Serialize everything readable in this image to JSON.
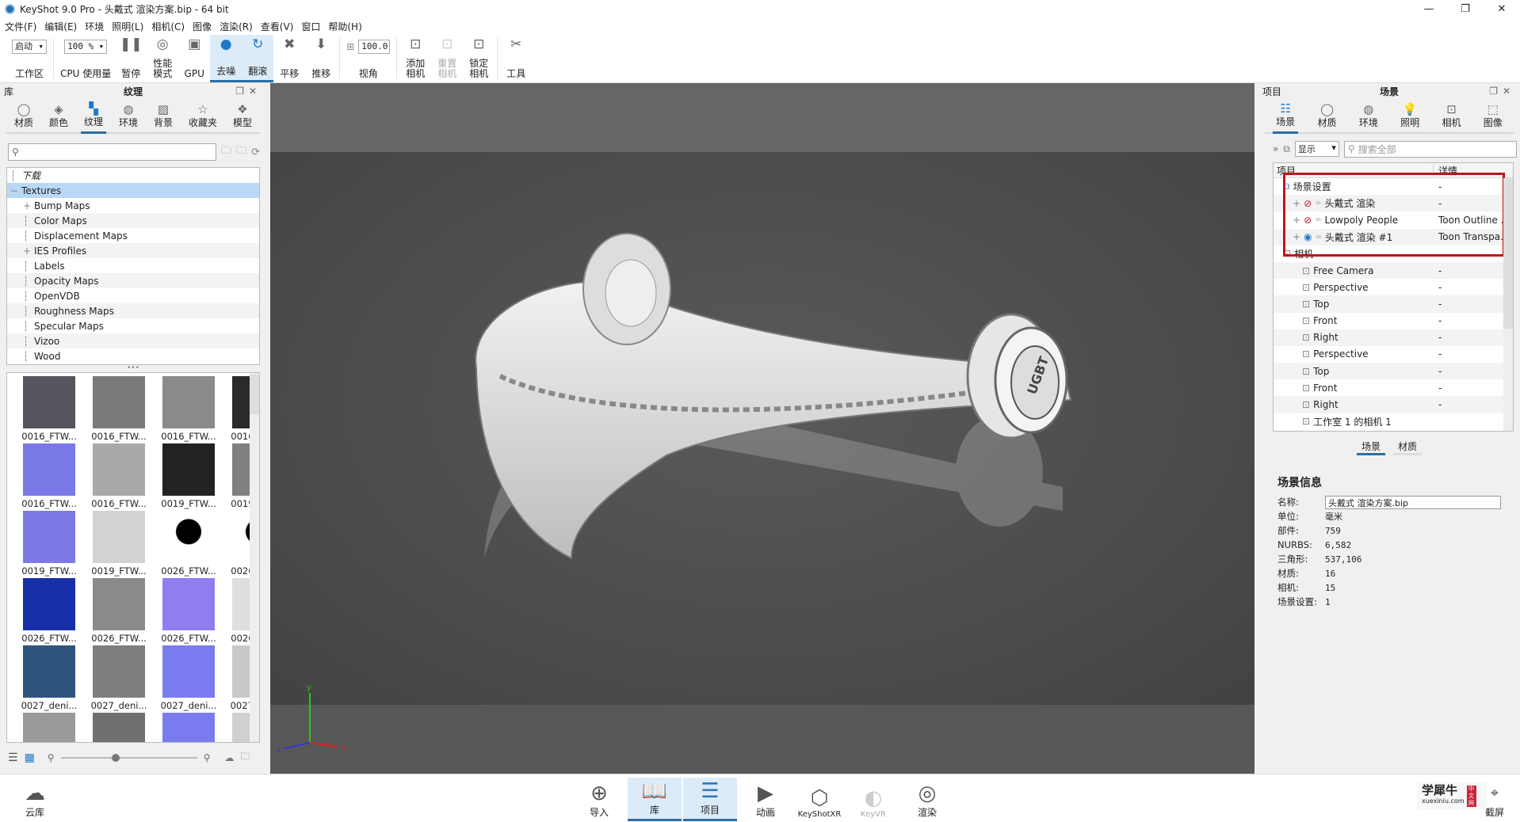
{
  "window": {
    "title": "KeyShot 9.0 Pro  - 头戴式 渲染方案.bip  - 64 bit",
    "controls": [
      "—",
      "❐",
      "✕"
    ]
  },
  "menu": [
    "文件(F)",
    "编辑(E)",
    "环境",
    "照明(L)",
    "相机(C)",
    "图像",
    "渲染(R)",
    "查看(V)",
    "窗口",
    "帮助(H)"
  ],
  "toolbar": {
    "workspace": {
      "value": "启动",
      "label": "工作区"
    },
    "cpu": {
      "value": "100 %",
      "label": "CPU 使用量"
    },
    "buttons": [
      {
        "label": "暂停",
        "icon": "pause-icon",
        "glyph": "❚❚"
      },
      {
        "label": "性能\n模式",
        "icon": "performance-icon",
        "glyph": "◎"
      },
      {
        "label": "GPU",
        "icon": "gpu-icon",
        "glyph": "▣"
      },
      {
        "label": "去噪",
        "icon": "denoise-icon",
        "glyph": "●",
        "active": true
      },
      {
        "label": "翻滚",
        "icon": "tumble-icon",
        "glyph": "↻",
        "active": true
      },
      {
        "label": "平移",
        "icon": "pan-icon",
        "glyph": "✖"
      },
      {
        "label": "推移",
        "icon": "dolly-icon",
        "glyph": "⬇"
      }
    ],
    "fov": {
      "value": "100.0",
      "label": "视角"
    },
    "camera_buttons": [
      {
        "label": "添加\n相机",
        "icon": "add-camera-icon",
        "glyph": "⊡"
      },
      {
        "label": "重置\n相机",
        "icon": "reset-camera-icon",
        "glyph": "⊡",
        "disabled": true
      },
      {
        "label": "锁定\n相机",
        "icon": "lock-camera-icon",
        "glyph": "⊡"
      }
    ],
    "tools": {
      "label": "工具",
      "icon": "tools-icon",
      "glyph": "✂"
    }
  },
  "library": {
    "panel_left": "库",
    "title": "纹理",
    "tabs": [
      {
        "label": "材质",
        "icon": "material-icon",
        "glyph": "◯"
      },
      {
        "label": "颜色",
        "icon": "color-icon",
        "glyph": "◈"
      },
      {
        "label": "纹理",
        "icon": "texture-icon",
        "glyph": "▚",
        "active": true
      },
      {
        "label": "环境",
        "icon": "environment-icon",
        "glyph": "◍"
      },
      {
        "label": "背景",
        "icon": "background-icon",
        "glyph": "▨"
      },
      {
        "label": "收藏夹",
        "icon": "favorites-icon",
        "glyph": "☆"
      },
      {
        "label": "模型",
        "icon": "models-icon",
        "glyph": "❖"
      }
    ],
    "search_placeholder": "",
    "tree": [
      {
        "label": "下载",
        "indent": 0,
        "italic": true
      },
      {
        "label": "Textures",
        "indent": 0,
        "expander": "−",
        "selected": true
      },
      {
        "label": "Bump Maps",
        "indent": 1,
        "expander": "+"
      },
      {
        "label": "Color Maps",
        "indent": 1
      },
      {
        "label": "Displacement Maps",
        "indent": 1
      },
      {
        "label": "IES Profiles",
        "indent": 1,
        "expander": "+"
      },
      {
        "label": "Labels",
        "indent": 1
      },
      {
        "label": "Opacity Maps",
        "indent": 1
      },
      {
        "label": "OpenVDB",
        "indent": 1
      },
      {
        "label": "Roughness Maps",
        "indent": 1
      },
      {
        "label": "Specular Maps",
        "indent": 1
      },
      {
        "label": "Vizoo",
        "indent": 1
      },
      {
        "label": "Wood",
        "indent": 1
      }
    ],
    "thumbnails": [
      {
        "label": "0016_FTW...",
        "color": "#58545e"
      },
      {
        "label": "0016_FTW...",
        "color": "#7a7a7a"
      },
      {
        "label": "0016_FTW...",
        "color": "#8a8a8a"
      },
      {
        "label": "0016_FTW...",
        "color": "#2a2a2a"
      },
      {
        "label": "0016_FTW...",
        "color": "#7b78e8"
      },
      {
        "label": "0016_FTW...",
        "color": "#a9a9a9"
      },
      {
        "label": "0019_FTW...",
        "color": "#222220"
      },
      {
        "label": "0019_FTW...",
        "color": "#808080"
      },
      {
        "label": "0019_FTW...",
        "color": "#7d7ae6"
      },
      {
        "label": "0019_FTW...",
        "color": "#d2d2d2"
      },
      {
        "label": "0026_FTW...",
        "color": "#ffffff",
        "pattern": "holes"
      },
      {
        "label": "0026_FTW...",
        "color": "#ffffff",
        "pattern": "holes"
      },
      {
        "label": "0026_FTW...",
        "color": "#1730a8"
      },
      {
        "label": "0026_FTW...",
        "color": "#8a8a8a"
      },
      {
        "label": "0026_FTW...",
        "color": "#8f7ef0"
      },
      {
        "label": "0026_FTW...",
        "color": "#dedede"
      },
      {
        "label": "0027_deni...",
        "color": "#2f557e"
      },
      {
        "label": "0027_deni...",
        "color": "#7e7e7e"
      },
      {
        "label": "0027_deni...",
        "color": "#7b7bf0"
      },
      {
        "label": "0027_deni...",
        "color": "#c9c9c9"
      },
      {
        "label": "",
        "color": "#9a9a9a"
      },
      {
        "label": "",
        "color": "#707070"
      },
      {
        "label": "",
        "color": "#7b7bf0"
      },
      {
        "label": "",
        "color": "#d0d0d0"
      }
    ],
    "zoom_slider": 0.4
  },
  "project": {
    "panel_left": "项目",
    "title": "场景",
    "tabs": [
      {
        "label": "场景",
        "icon": "scene-icon",
        "glyph": "☷",
        "active": true
      },
      {
        "label": "材质",
        "icon": "material-icon",
        "glyph": "◯"
      },
      {
        "label": "环境",
        "icon": "environment-icon",
        "glyph": "◍"
      },
      {
        "label": "照明",
        "icon": "lighting-icon",
        "glyph": "💡"
      },
      {
        "label": "相机",
        "icon": "camera-icon",
        "glyph": "⊡"
      },
      {
        "label": "图像",
        "icon": "image-icon",
        "glyph": "⬚"
      }
    ],
    "show_select": "显示",
    "search_placeholder": "搜索全部",
    "columns": [
      "项目",
      "详情"
    ],
    "rows": [
      {
        "label": "场景设置",
        "detail": "-",
        "indent": 1,
        "icon": "scene-set-icon"
      },
      {
        "label": "头戴式 渲染",
        "detail": "-",
        "indent": 2,
        "expander": "+",
        "visible": false
      },
      {
        "label": "Lowpoly People",
        "detail": "Toon Outline ...",
        "indent": 2,
        "expander": "+",
        "visible": false
      },
      {
        "label": "头戴式 渲染 #1",
        "detail": "Toon Transpa...",
        "indent": 2,
        "expander": "+",
        "visible": true
      },
      {
        "label": "相机",
        "detail": "",
        "indent": 1,
        "icon": "camera"
      },
      {
        "label": "Free Camera",
        "detail": "-",
        "indent": 3,
        "icon": "camera"
      },
      {
        "label": "Perspective",
        "detail": "-",
        "indent": 3,
        "icon": "camera"
      },
      {
        "label": "Top",
        "detail": "-",
        "indent": 3,
        "icon": "camera"
      },
      {
        "label": "Front",
        "detail": "-",
        "indent": 3,
        "icon": "camera"
      },
      {
        "label": "Right",
        "detail": "-",
        "indent": 3,
        "icon": "camera"
      },
      {
        "label": "Perspective",
        "detail": "-",
        "indent": 3,
        "icon": "camera"
      },
      {
        "label": "Top",
        "detail": "-",
        "indent": 3,
        "icon": "camera"
      },
      {
        "label": "Front",
        "detail": "-",
        "indent": 3,
        "icon": "camera"
      },
      {
        "label": "Right",
        "detail": "-",
        "indent": 3,
        "icon": "camera"
      },
      {
        "label": "工作室 1 的相机 1",
        "detail": "",
        "indent": 3,
        "icon": "camera"
      }
    ],
    "highlight_color": "#c0141c",
    "subtabs": [
      "场景",
      "材质"
    ],
    "info": {
      "title": "场景信息",
      "name_label": "名称:",
      "name_value": "头戴式 渲染方案.bip",
      "rows": [
        {
          "k": "单位:",
          "v": "毫米"
        },
        {
          "k": "部件:",
          "v": "759"
        },
        {
          "k": "NURBS:",
          "v": "6,582"
        },
        {
          "k": "三角形:",
          "v": "537,106"
        },
        {
          "k": "材质:",
          "v": "16"
        },
        {
          "k": "相机:",
          "v": "15"
        },
        {
          "k": "场景设置:",
          "v": "1"
        }
      ]
    }
  },
  "viewport": {
    "axis_labels": [
      "y",
      "x",
      "z"
    ],
    "logo_text": "UGBT"
  },
  "bottombar": {
    "cloud": "云库",
    "items": [
      {
        "label": "导入",
        "icon": "import-icon",
        "glyph": "⊕"
      },
      {
        "label": "库",
        "icon": "library-icon",
        "glyph": "📖",
        "active": true
      },
      {
        "label": "项目",
        "icon": "project-icon",
        "glyph": "☰",
        "active": true
      },
      {
        "label": "动画",
        "icon": "animation-icon",
        "glyph": "▶"
      },
      {
        "label": "KeyShotXR",
        "icon": "keyshotxr-icon",
        "glyph": "⬡"
      },
      {
        "label": "KeyVR",
        "icon": "keyvr-icon",
        "glyph": "◐",
        "disabled": true
      },
      {
        "label": "渲染",
        "icon": "render-icon",
        "glyph": "◎"
      }
    ],
    "screenshot": "截屏",
    "watermark": {
      "main": "学犀牛",
      "sub": "xuexiniu.com",
      "badge": "中文网"
    }
  }
}
